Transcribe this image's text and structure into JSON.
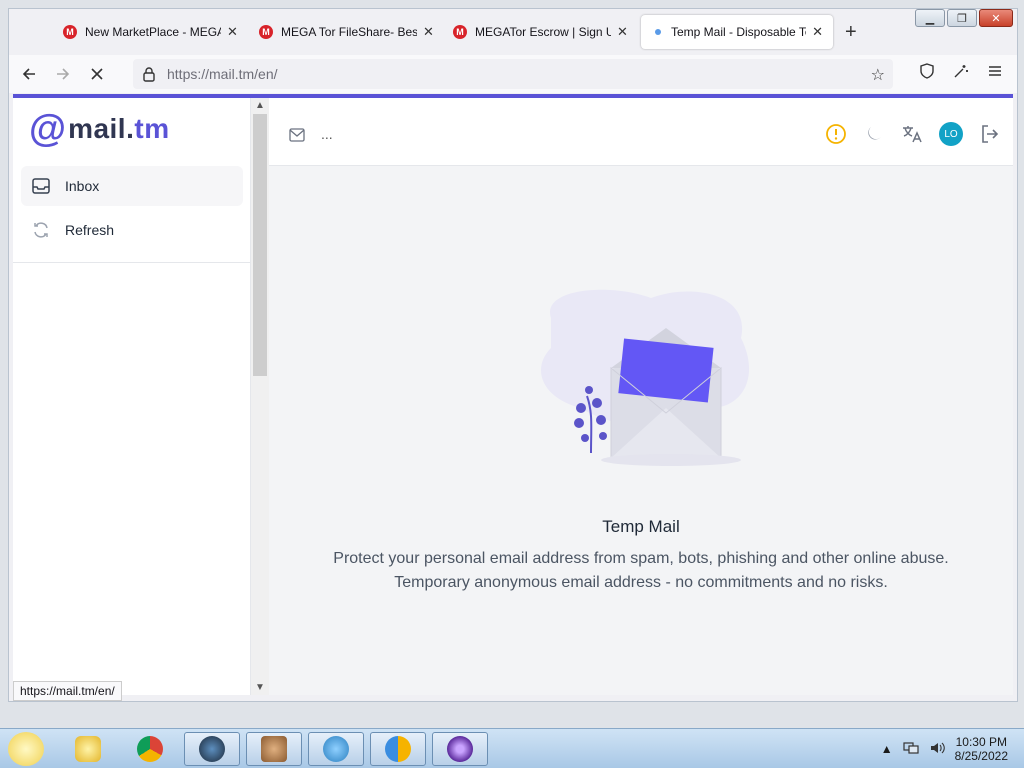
{
  "browser": {
    "tabs": [
      {
        "title": "New MarketPlace - MEGA",
        "favicon": "M"
      },
      {
        "title": "MEGA Tor FileShare- Best",
        "favicon": "M"
      },
      {
        "title": "MEGATor Escrow | Sign Up",
        "favicon": "M"
      },
      {
        "title": "Temp Mail - Disposable Te",
        "favicon": ""
      }
    ],
    "new_tab": "+",
    "url_host": "https://mail.tm",
    "url_path": "/en/",
    "status_url": "https://mail.tm/en/"
  },
  "app": {
    "logo_at": "@",
    "logo_name": "mail.",
    "logo_tld": "tm",
    "sidebar": {
      "items": [
        {
          "label": "Inbox",
          "icon": "inbox-icon"
        },
        {
          "label": "Refresh",
          "icon": "refresh-icon"
        }
      ]
    },
    "topbar": {
      "dots": "...",
      "avatar": "LO"
    },
    "empty_state": {
      "title": "Temp Mail",
      "line1": "Protect your personal email address from spam, bots, phishing and other online abuse.",
      "line2": "Temporary anonymous email address - no commitments and no risks."
    }
  },
  "taskbar": {
    "time": "10:30 PM",
    "date": "8/25/2022"
  },
  "colors": {
    "accent": "#5a53d6",
    "avatar": "#12a2c6",
    "warning": "#f5b300"
  }
}
